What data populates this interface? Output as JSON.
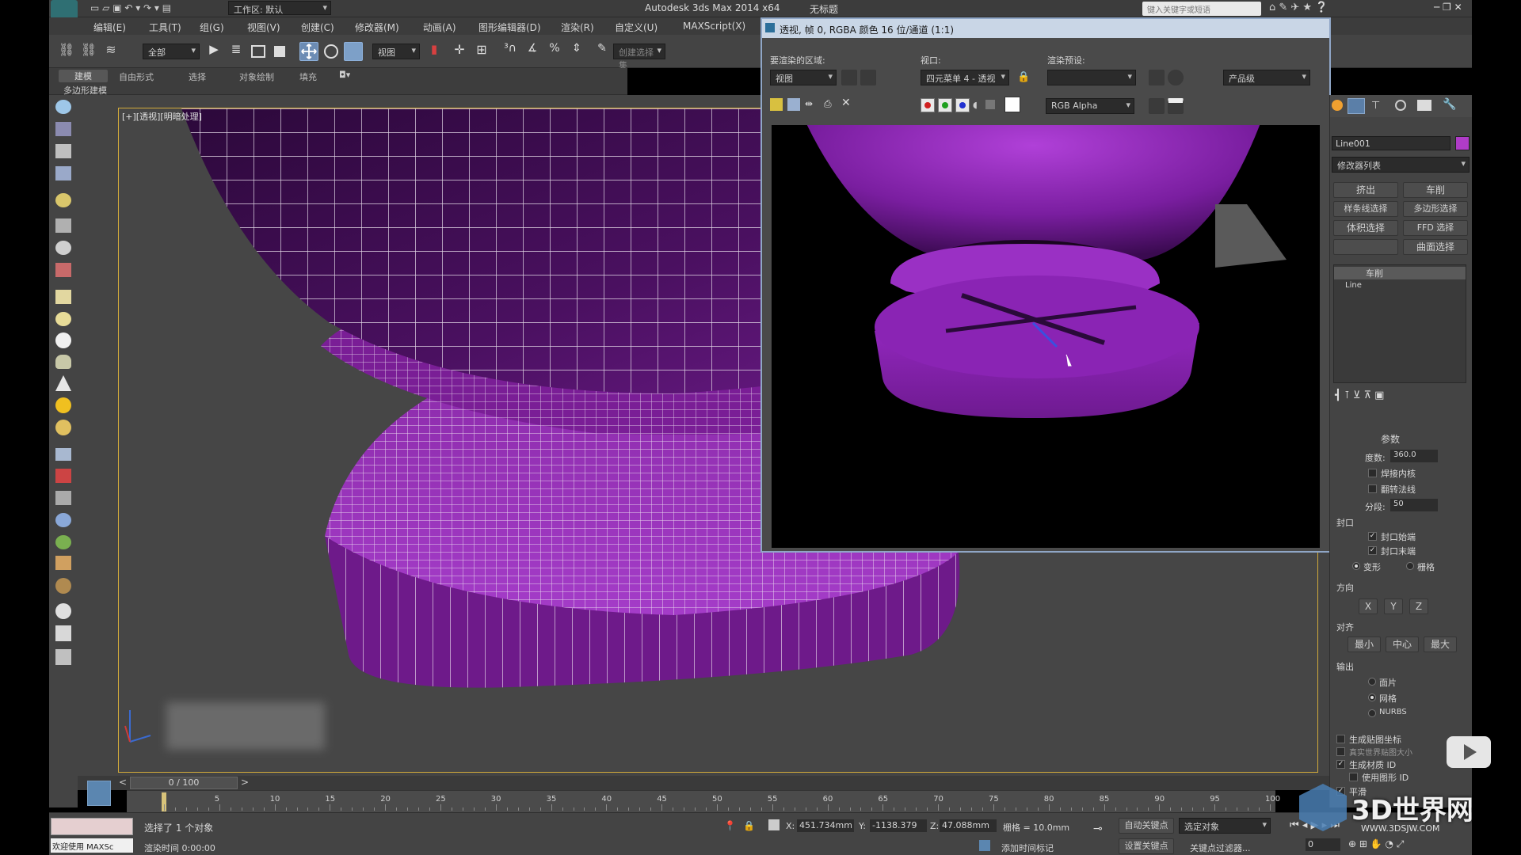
{
  "app": {
    "title": "Autodesk 3ds Max  2014 x64",
    "file_title": "无标题",
    "workspace": "工作区: 默认",
    "search_placeholder": "键入关键字或短语"
  },
  "menu": [
    "编辑(E)",
    "工具(T)",
    "组(G)",
    "视图(V)",
    "创建(C)",
    "修改器(M)",
    "动画(A)",
    "图形编辑器(D)",
    "渲染(R)",
    "自定义(U)",
    "MAXScript(X)"
  ],
  "toolbar": {
    "selection_filter": "全部",
    "ref_coord": "视图",
    "named_selection_placeholder": "创建选择集"
  },
  "ribbon_tabs": [
    "建模",
    "自由形式",
    "选择",
    "对象绘制",
    "填充"
  ],
  "ribbon_sub": "多边形建模",
  "viewport": {
    "label": "[+][透视][明暗处理]"
  },
  "render_window": {
    "title": "透视, 帧 0, RGBA 颜色 16 位/通道 (1:1)",
    "area_label": "要渲染的区域:",
    "area_value": "视图",
    "viewport_label": "视口:",
    "viewport_value": "四元菜单 4 - 透视",
    "preset_label": "渲染预设:",
    "preset_value": "",
    "product_value": "产品级",
    "channel_value": "RGB Alpha"
  },
  "command_panel": {
    "object_name": "Line001",
    "object_color": "#b03cc8",
    "modifier_list_label": "修改器列表",
    "mod_buttons": [
      "挤出",
      "车削",
      "样条线选择",
      "多边形选择",
      "体积选择",
      "FFD 选择",
      "",
      "曲面选择"
    ],
    "stack": [
      "车削",
      "Line"
    ],
    "params_title": "参数",
    "degrees_label": "度数:",
    "degrees_value": "360.0",
    "weld_core": "焊接内核",
    "flip_normals": "翻转法线",
    "segments_label": "分段:",
    "segments_value": "50",
    "capping_title": "封口",
    "cap_start": "封口始端",
    "cap_end": "封口末端",
    "morph": "变形",
    "grid": "栅格",
    "direction_title": "方向",
    "dir_buttons": [
      "X",
      "Y",
      "Z"
    ],
    "align_title": "对齐",
    "align_buttons": [
      "最小",
      "中心",
      "最大"
    ],
    "output_title": "输出",
    "output_options": [
      "面片",
      "网格",
      "NURBS"
    ],
    "gen_map_coords": "生成贴图坐标",
    "real_world": "真实世界贴图大小",
    "gen_mat_ids": "生成材质 ID",
    "use_shape_ids": "使用图形 ID",
    "smooth": "平滑"
  },
  "timeline": {
    "frame_counter": "0 / 100",
    "ticks": [
      5,
      10,
      15,
      20,
      25,
      30,
      35,
      40,
      45,
      50,
      55,
      60,
      65,
      70,
      75,
      80,
      85,
      90,
      95,
      100
    ]
  },
  "status": {
    "selected": "选择了 1 个对象",
    "render_time": "渲染时间  0:00:00",
    "welcome": "欢迎使用  MAXSc",
    "x_label": "X:",
    "x_value": "451.734mm",
    "y_label": "Y:",
    "y_value": "-1138.379",
    "z_label": "Z:",
    "z_value": "47.088mm",
    "grid_value": "栅格 = 10.0mm",
    "add_time_tag": "添加时间标记",
    "auto_key": "自动关键点",
    "set_key": "设置关键点",
    "selected_object": "选定对象",
    "key_filters": "关键点过滤器...",
    "frame_field": "0"
  },
  "watermark": {
    "brand": "3D世界网",
    "url": "WWW.3DSJW.COM"
  },
  "colors": {
    "accent_purple": "#7a1a96",
    "ui_gray": "#444444",
    "highlight_blue": "#3c78c8"
  }
}
